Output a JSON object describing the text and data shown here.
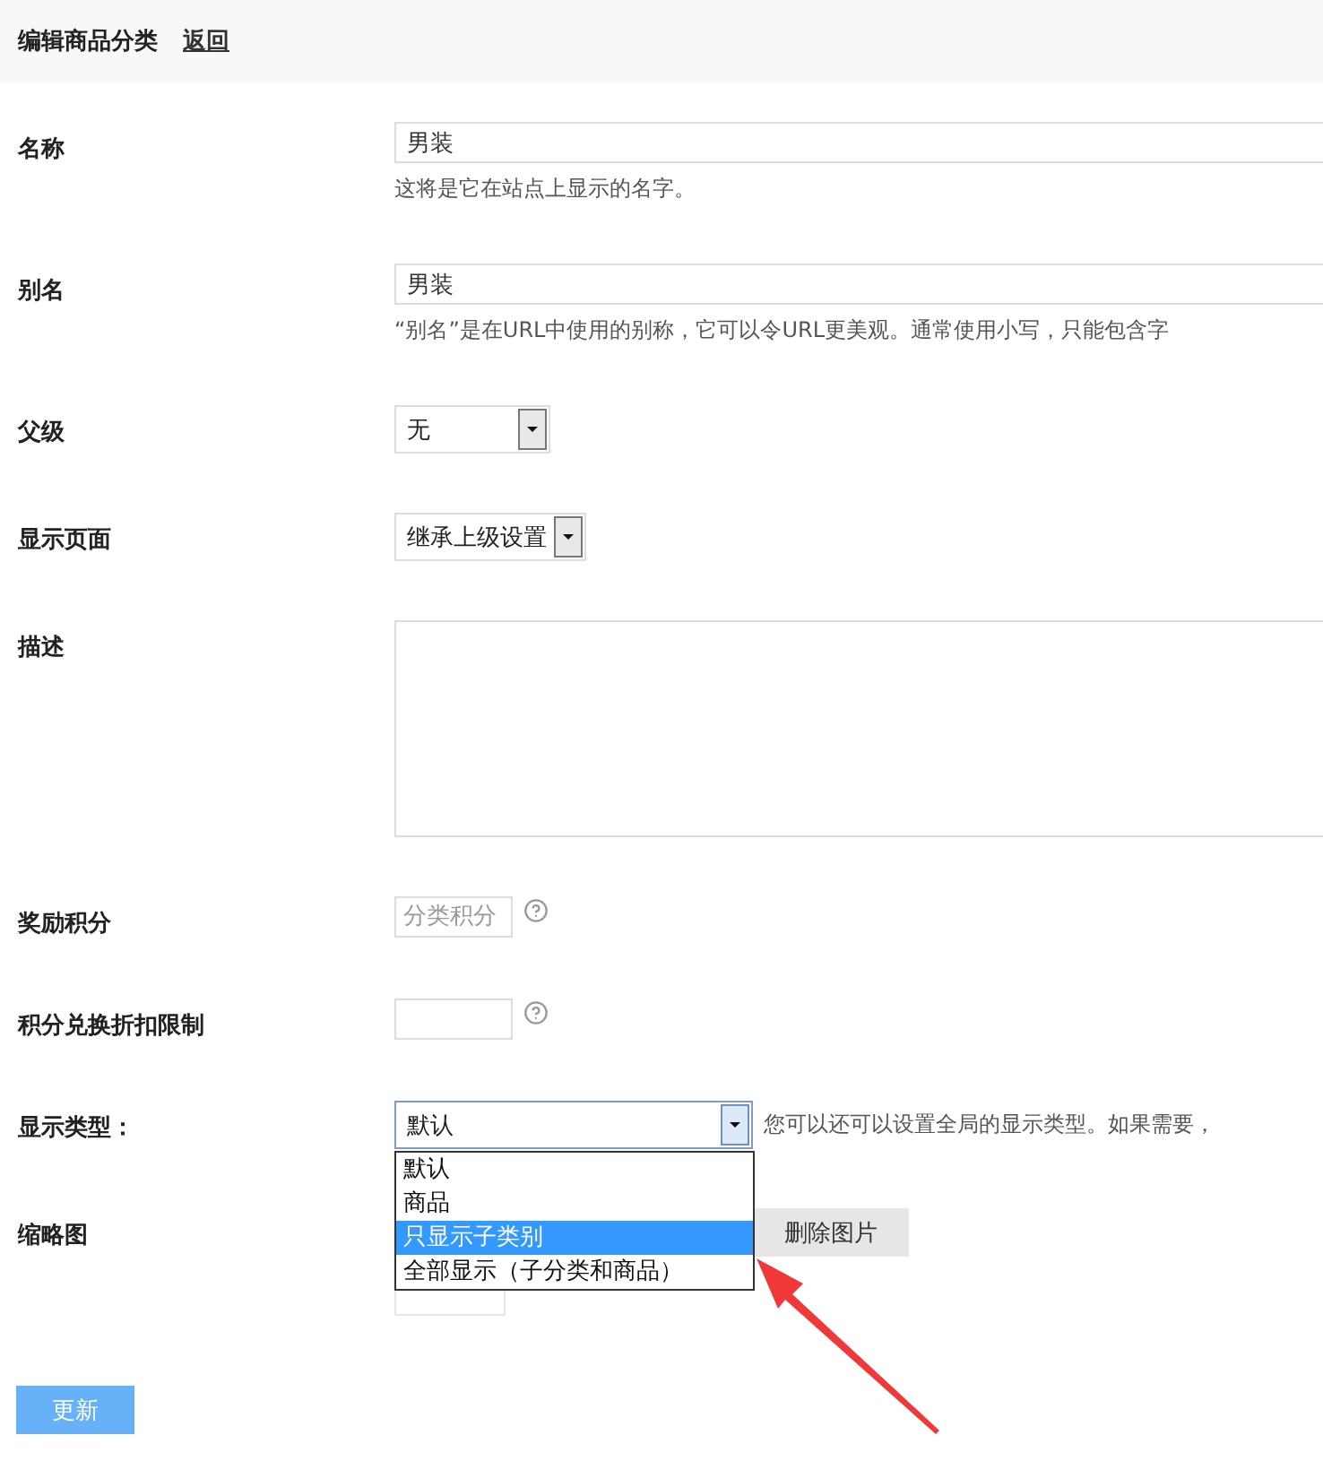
{
  "header": {
    "title": "编辑商品分类",
    "back_link": "返回"
  },
  "fields": [
    {
      "kind": "text",
      "label": "名称",
      "value": "男装",
      "hint": "这将是它在站点上显示的名字。"
    },
    {
      "kind": "text",
      "label": "别名",
      "value": "男装",
      "hint": "“别名”是在URL中使用的别称，它可以令URL更美观。通常使用小写，只能包含字"
    },
    {
      "kind": "select",
      "label": "父级",
      "value": "无"
    },
    {
      "kind": "select",
      "label": "显示页面",
      "value": "继承上级设置"
    },
    {
      "kind": "textarea",
      "label": "描述"
    },
    {
      "kind": "points",
      "label": "奖励积分",
      "placeholder": "分类积分"
    },
    {
      "kind": "points",
      "label": "积分兑换折扣限制"
    },
    {
      "kind": "dropdown",
      "label": "显示类型：",
      "value": "默认",
      "hint": "您可以还可以设置全局的显示类型。如果需要，",
      "options": [
        {
          "label": "默认",
          "highlighted": false
        },
        {
          "label": "商品",
          "highlighted": false
        },
        {
          "label": "只显示子类别",
          "highlighted": true
        },
        {
          "label": "全部显示（子分类和商品）",
          "highlighted": false
        }
      ]
    },
    {
      "kind": "thumbnail",
      "label": "缩略图",
      "button": "删除图片"
    }
  ],
  "submit": "更新"
}
